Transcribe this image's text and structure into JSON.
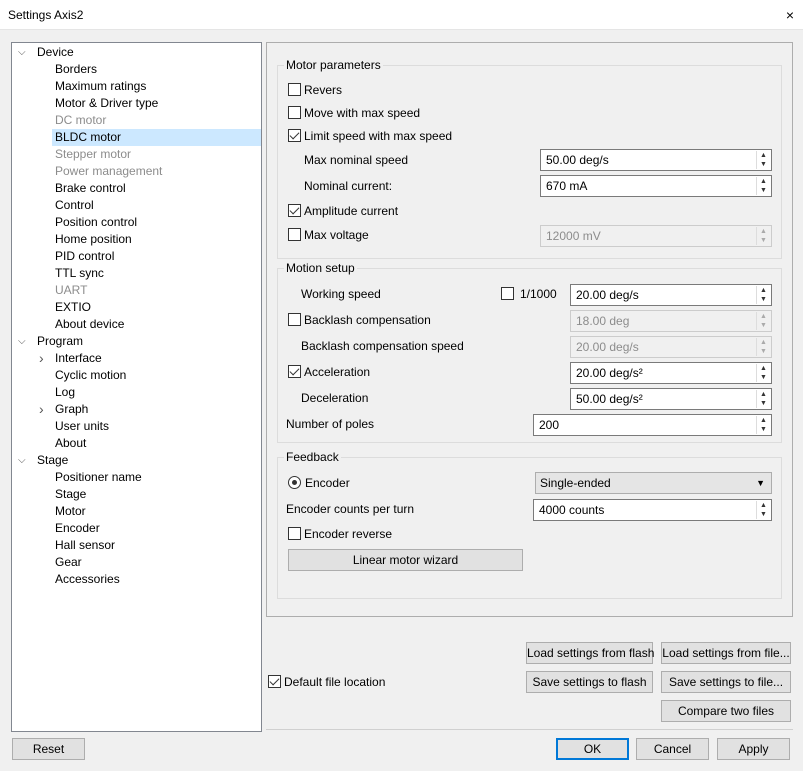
{
  "window": {
    "title": "Settings Axis2",
    "close": "×"
  },
  "tree": [
    {
      "label": "Device",
      "level": 0,
      "expanded": true
    },
    {
      "label": "Borders",
      "level": 1
    },
    {
      "label": "Maximum ratings",
      "level": 1
    },
    {
      "label": "Motor & Driver type",
      "level": 1
    },
    {
      "label": "DC motor",
      "level": 1,
      "disabled": true
    },
    {
      "label": "BLDC motor",
      "level": 1,
      "selected": true
    },
    {
      "label": "Stepper motor",
      "level": 1,
      "disabled": true
    },
    {
      "label": "Power management",
      "level": 1,
      "disabled": true
    },
    {
      "label": "Brake control",
      "level": 1
    },
    {
      "label": "Control",
      "level": 1
    },
    {
      "label": "Position control",
      "level": 1
    },
    {
      "label": "Home position",
      "level": 1
    },
    {
      "label": "PID control",
      "level": 1
    },
    {
      "label": "TTL sync",
      "level": 1
    },
    {
      "label": "UART",
      "level": 1,
      "disabled": true
    },
    {
      "label": "EXTIO",
      "level": 1
    },
    {
      "label": "About device",
      "level": 1
    },
    {
      "label": "Program",
      "level": 0,
      "expanded": true
    },
    {
      "label": "Interface",
      "level": 1,
      "collapsed": true
    },
    {
      "label": "Cyclic motion",
      "level": 1
    },
    {
      "label": "Log",
      "level": 1
    },
    {
      "label": "Graph",
      "level": 1,
      "collapsed": true
    },
    {
      "label": "User units",
      "level": 1
    },
    {
      "label": "About",
      "level": 1
    },
    {
      "label": "Stage",
      "level": 0,
      "expanded": true
    },
    {
      "label": "Positioner name",
      "level": 1
    },
    {
      "label": "Stage",
      "level": 1
    },
    {
      "label": "Motor",
      "level": 1
    },
    {
      "label": "Encoder",
      "level": 1
    },
    {
      "label": "Hall sensor",
      "level": 1
    },
    {
      "label": "Gear",
      "level": 1
    },
    {
      "label": "Accessories",
      "level": 1
    }
  ],
  "motor": {
    "title": "Motor parameters",
    "revers": "Revers",
    "move_max": "Move with max speed",
    "limit_speed": "Limit speed with max speed",
    "max_nominal_speed_label": "Max nominal speed",
    "max_nominal_speed": "50.00 deg/s",
    "nominal_current_label": "Nominal current:",
    "nominal_current": "670 mA",
    "amplitude_current": "Amplitude current",
    "max_voltage_label": "Max voltage",
    "max_voltage": "12000 mV"
  },
  "motion": {
    "title": "Motion setup",
    "working_speed_label": "Working speed",
    "div1000": "1/1000",
    "working_speed": "20.00 deg/s",
    "backlash_label": "Backlash compensation",
    "backlash": "18.00 deg",
    "backlash_speed_label": "Backlash compensation speed",
    "backlash_speed": "20.00 deg/s",
    "acceleration_label": "Acceleration",
    "acceleration": "20.00 deg/s²",
    "deceleration_label": "Deceleration",
    "deceleration": "50.00 deg/s²",
    "poles_label": "Number of poles",
    "poles": "200"
  },
  "feedback": {
    "title": "Feedback",
    "encoder_label": "Encoder",
    "encoder_type": "Single-ended",
    "counts_label": "Encoder counts per turn",
    "counts": "4000 counts",
    "reverse_label": "Encoder reverse",
    "wizard": "Linear motor wizard"
  },
  "files": {
    "default_location": "Default file location",
    "load_flash": "Load settings from flash",
    "load_file": "Load settings from file...",
    "save_flash": "Save settings to flash",
    "save_file": "Save settings to file...",
    "compare": "Compare two files"
  },
  "footer": {
    "reset": "Reset",
    "ok": "OK",
    "cancel": "Cancel",
    "apply": "Apply"
  },
  "colors": {
    "selection": "#cce8ff",
    "accent": "#0078d7"
  }
}
